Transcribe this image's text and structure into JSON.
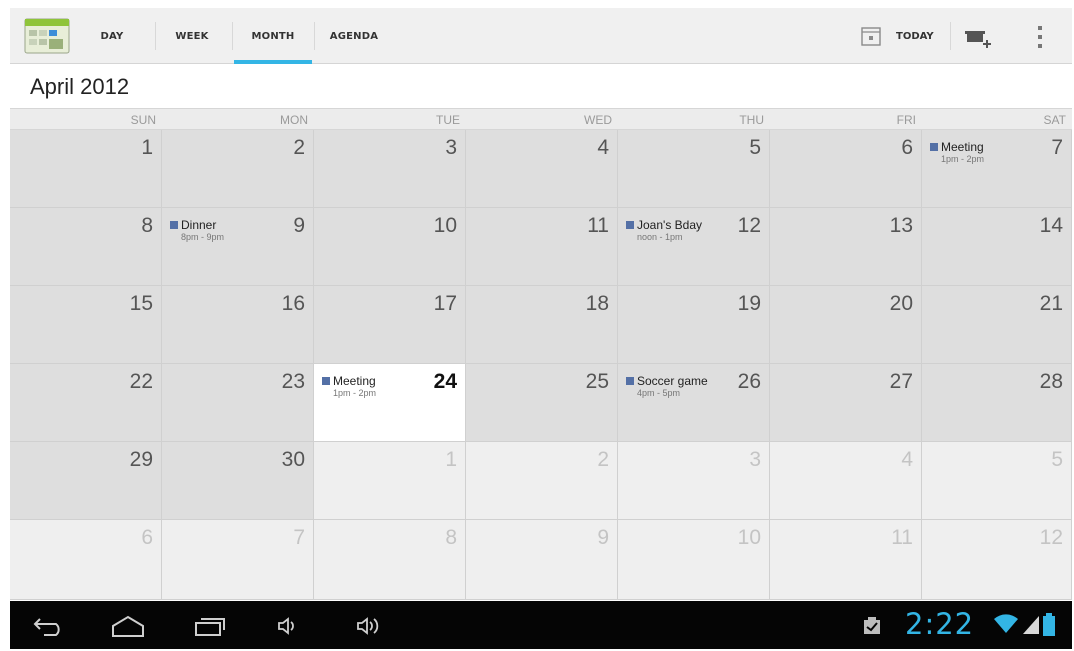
{
  "action_bar": {
    "app_icon": "calendar-app-icon",
    "tabs": [
      {
        "label": "DAY",
        "active": false
      },
      {
        "label": "WEEK",
        "active": false
      },
      {
        "label": "MONTH",
        "active": true
      },
      {
        "label": "AGENDA",
        "active": false
      }
    ],
    "today_label": "TODAY",
    "icons": [
      "calendar-today-icon",
      "new-event-icon",
      "overflow-menu-icon"
    ],
    "accent_color": "#33b5e5"
  },
  "month_title": "April 2012",
  "weekdays": [
    "SUN",
    "MON",
    "TUE",
    "WED",
    "THU",
    "FRI",
    "SAT"
  ],
  "weeks": [
    [
      {
        "day": "1"
      },
      {
        "day": "2"
      },
      {
        "day": "3"
      },
      {
        "day": "4"
      },
      {
        "day": "5"
      },
      {
        "day": "6"
      },
      {
        "day": "7"
      }
    ],
    [
      {
        "day": "8"
      },
      {
        "day": "9"
      },
      {
        "day": "10"
      },
      {
        "day": "11"
      },
      {
        "day": "12"
      },
      {
        "day": "13"
      },
      {
        "day": "14"
      }
    ],
    [
      {
        "day": "15"
      },
      {
        "day": "16"
      },
      {
        "day": "17"
      },
      {
        "day": "18"
      },
      {
        "day": "19"
      },
      {
        "day": "20"
      },
      {
        "day": "21"
      }
    ],
    [
      {
        "day": "22"
      },
      {
        "day": "23"
      },
      {
        "day": "24"
      },
      {
        "day": "25"
      },
      {
        "day": "26"
      },
      {
        "day": "27"
      },
      {
        "day": "28"
      }
    ],
    [
      {
        "day": "29"
      },
      {
        "day": "30"
      },
      {
        "day": "1"
      },
      {
        "day": "2"
      },
      {
        "day": "3"
      },
      {
        "day": "4"
      },
      {
        "day": "5"
      }
    ],
    [
      {
        "day": "6"
      },
      {
        "day": "7"
      },
      {
        "day": "8"
      },
      {
        "day": "9"
      },
      {
        "day": "10"
      },
      {
        "day": "11"
      },
      {
        "day": "12"
      }
    ]
  ],
  "events": {
    "apr6": {
      "title": "Meeting",
      "time": "1pm - 2pm"
    },
    "apr8": {
      "title": "Dinner",
      "time": "8pm - 9pm"
    },
    "apr11": {
      "title": "Joan's Bday",
      "time": "noon - 1pm"
    },
    "apr23": {
      "title": "Meeting",
      "time": "1pm - 2pm"
    },
    "apr25": {
      "title": "Soccer game",
      "time": "4pm - 5pm"
    }
  },
  "event_color": "#5470a6",
  "today": "24",
  "system_bar": {
    "clock": "2:22",
    "icons": [
      "back-icon",
      "home-icon",
      "recent-apps-icon",
      "volume-down-icon",
      "volume-up-icon",
      "notification-icon",
      "wifi-icon",
      "signal-icon",
      "battery-icon"
    ]
  }
}
